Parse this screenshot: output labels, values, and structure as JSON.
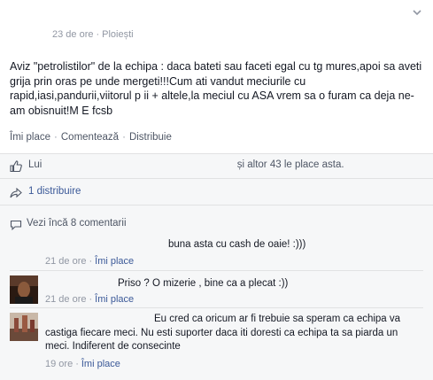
{
  "post": {
    "time": "23 de ore",
    "location": "Ploiești",
    "text": "Aviz \"petrolistilor\" de la echipa : daca bateti sau faceti egal cu tg mures,apoi sa aveti grija prin oras pe unde mergeti!!!Cum ati vandut meciurile cu rapid,iasi,pandurii,viitorul p    ii + altele,la meciul cu ASA vrem sa o furam ca deja ne-am obisnuit!M    E fcsb",
    "actions": [
      "Îmi place",
      "Comentează",
      "Distribuie"
    ]
  },
  "likes": {
    "prefix": "Lui",
    "suffix": "și altor 43 le place asta."
  },
  "shares": {
    "label": "1 distribuire"
  },
  "more_comments": {
    "label": "Vezi încă 8 comentarii"
  },
  "comments": [
    {
      "text": "buna asta cu cash de oaie! :)))",
      "time": "21 de ore",
      "like": "Îmi place"
    },
    {
      "text": "Priso ? O mizerie , bine ca a plecat :))",
      "time": "21 de ore",
      "like": "Îmi place"
    },
    {
      "text": "Eu cred ca oricum ar fi trebuie sa speram ca echipa va castiga fiecare meci. Nu esti suporter daca iti doresti ca echipa ta sa piarda un meci. Indiferent de consecinte",
      "time": "19 ore",
      "like": "Îmi place"
    }
  ],
  "colors": {
    "link": "#3b5998",
    "meta": "#9197a3",
    "panel": "#f6f7f8"
  }
}
